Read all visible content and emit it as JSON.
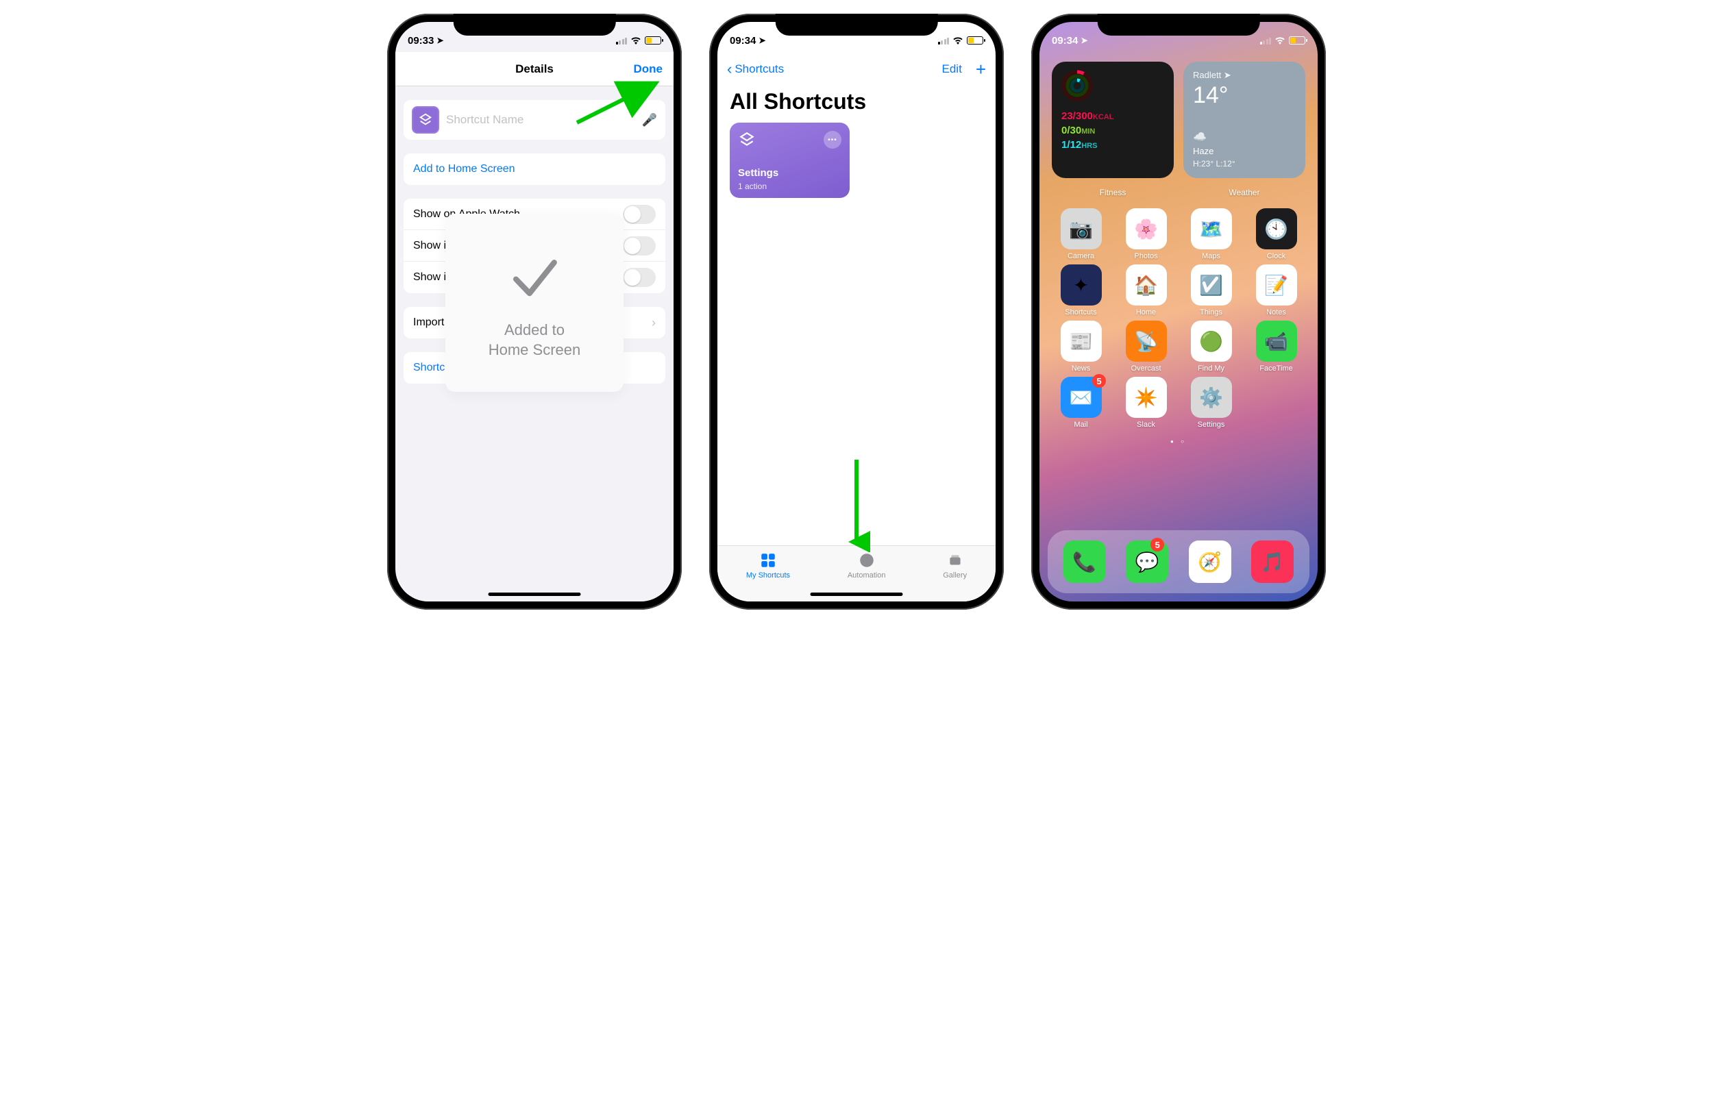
{
  "colors": {
    "accent": "#007aff",
    "shortcut": "#8e6dd9",
    "arrow": "#00c800",
    "batteryLow": "#ffcc00"
  },
  "screen1": {
    "time": "09:33",
    "header": {
      "title": "Details",
      "done": "Done"
    },
    "nameField": {
      "placeholder": "Shortcut Name"
    },
    "actions": {
      "addHome": "Add to Home Screen",
      "help": "Shortcuts Help",
      "import": "Import Questions"
    },
    "toggles": [
      {
        "label": "Show on Apple Watch"
      },
      {
        "label": "Show in Share Sheet"
      },
      {
        "label": "Show in Sleep Mode"
      }
    ],
    "overlay": {
      "line1": "Added to",
      "line2": "Home Screen"
    }
  },
  "screen2": {
    "time": "09:34",
    "nav": {
      "back": "Shortcuts",
      "edit": "Edit"
    },
    "title": "All Shortcuts",
    "tile": {
      "name": "Settings",
      "sub": "1 action"
    },
    "tabs": [
      "My Shortcuts",
      "Automation",
      "Gallery"
    ]
  },
  "screen3": {
    "time": "09:34",
    "fitness": {
      "label": "Fitness",
      "kcal_val": "23/300",
      "kcal_unit": "KCAL",
      "min_val": "0/30",
      "min_unit": "MIN",
      "hrs_val": "1/12",
      "hrs_unit": "HRS"
    },
    "weather": {
      "label": "Weather",
      "loc": "Radlett",
      "temp": "14°",
      "cond": "Haze",
      "hilo": "H:23° L:12°"
    },
    "apps": [
      {
        "name": "Camera",
        "bg": "#d9d9d9",
        "glyph": "📷"
      },
      {
        "name": "Photos",
        "bg": "#ffffff",
        "glyph": "🌸"
      },
      {
        "name": "Maps",
        "bg": "#ffffff",
        "glyph": "🗺️"
      },
      {
        "name": "Clock",
        "bg": "#1c1c1e",
        "glyph": "🕙"
      },
      {
        "name": "Shortcuts",
        "bg": "#1f2a5a",
        "glyph": "✦"
      },
      {
        "name": "Home",
        "bg": "#ffffff",
        "glyph": "🏠"
      },
      {
        "name": "Things",
        "bg": "#ffffff",
        "glyph": "☑️"
      },
      {
        "name": "Notes",
        "bg": "#ffffff",
        "glyph": "📝"
      },
      {
        "name": "News",
        "bg": "#ffffff",
        "glyph": "📰"
      },
      {
        "name": "Overcast",
        "bg": "#fc7e0f",
        "glyph": "📡"
      },
      {
        "name": "Find My",
        "bg": "#ffffff",
        "glyph": "🟢"
      },
      {
        "name": "FaceTime",
        "bg": "#32d74b",
        "glyph": "📹"
      },
      {
        "name": "Mail",
        "bg": "#1e90ff",
        "glyph": "✉️",
        "badge": "5"
      },
      {
        "name": "Slack",
        "bg": "#ffffff",
        "glyph": "✴️"
      },
      {
        "name": "Settings",
        "bg": "#d9d9d9",
        "glyph": "⚙️"
      }
    ],
    "dock": [
      {
        "name": "Phone",
        "bg": "#32d74b",
        "glyph": "📞"
      },
      {
        "name": "Messages",
        "bg": "#32d74b",
        "glyph": "💬",
        "badge": "5"
      },
      {
        "name": "Safari",
        "bg": "#ffffff",
        "glyph": "🧭"
      },
      {
        "name": "Music",
        "bg": "#fc3158",
        "glyph": "🎵"
      }
    ]
  }
}
